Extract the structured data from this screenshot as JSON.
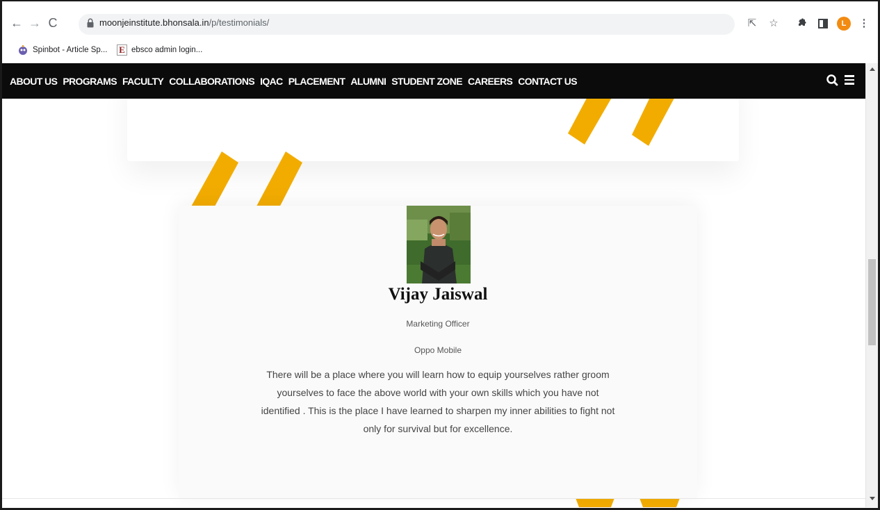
{
  "browser": {
    "url_host": "moonjeinstitute.bhonsala.in",
    "url_path": "/p/testimonials/",
    "profile_initial": "L",
    "bookmarks": [
      {
        "label": "Spinbot - Article Sp...",
        "icon": "spinbot-icon"
      },
      {
        "label": "ebsco admin login...",
        "icon": "ebsco-e-icon"
      }
    ]
  },
  "site_nav": {
    "items": [
      "ABOUT US",
      "PROGRAMS",
      "FACULTY",
      "COLLABORATIONS",
      "IQAC",
      "PLACEMENT",
      "ALUMNI",
      "STUDENT ZONE",
      "CAREERS",
      "CONTACT US"
    ],
    "background": "#0b0b0b"
  },
  "testimonial": {
    "name": "Vijay Jaiswal",
    "role": "Marketing Officer",
    "company": "Oppo Mobile",
    "quote": "There will be a place where you will learn how to equip yourselves rather groom yourselves to face the above world with your own skills which you have not identified . This is the place I have learned to sharpen my inner abilities to fight not only for survival but for excellence."
  },
  "colors": {
    "accent": "#f2ac00",
    "card_bg": "#fafafa"
  }
}
